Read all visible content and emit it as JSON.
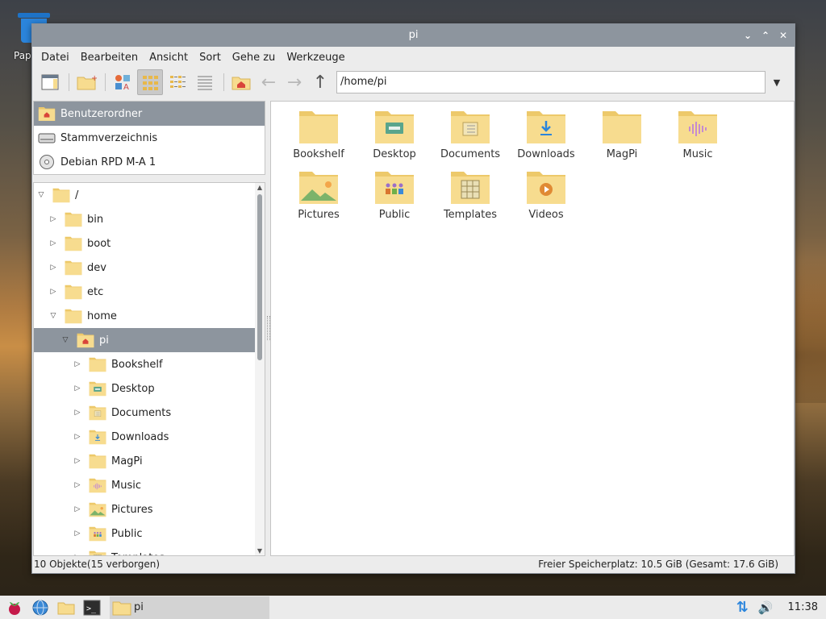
{
  "desktop": {
    "trash_label": "Papierkorb"
  },
  "window": {
    "title": "pi",
    "controls": {
      "minimize": "⌄",
      "maximize": "⌃",
      "close": "✕"
    }
  },
  "menubar": [
    "Datei",
    "Bearbeiten",
    "Ansicht",
    "Sort",
    "Gehe zu",
    "Werkzeuge"
  ],
  "toolbar": {
    "path": "/home/pi",
    "path_dropdown": "▼"
  },
  "places": [
    {
      "label": "Benutzerordner",
      "icon": "home-folder-icon",
      "selected": true
    },
    {
      "label": "Stammverzeichnis",
      "icon": "harddisk-icon",
      "selected": false
    },
    {
      "label": "Debian RPD M-A 1",
      "icon": "cdrom-icon",
      "selected": false
    }
  ],
  "tree": [
    {
      "label": "/",
      "depth": 0,
      "expander": "▽",
      "selected": false
    },
    {
      "label": "bin",
      "depth": 1,
      "expander": "▷",
      "selected": false
    },
    {
      "label": "boot",
      "depth": 1,
      "expander": "▷",
      "selected": false
    },
    {
      "label": "dev",
      "depth": 1,
      "expander": "▷",
      "selected": false
    },
    {
      "label": "etc",
      "depth": 1,
      "expander": "▷",
      "selected": false
    },
    {
      "label": "home",
      "depth": 1,
      "expander": "▽",
      "selected": false
    },
    {
      "label": "pi",
      "depth": 2,
      "expander": "▽",
      "selected": true,
      "icon": "home"
    },
    {
      "label": "Bookshelf",
      "depth": 3,
      "expander": "▷",
      "selected": false
    },
    {
      "label": "Desktop",
      "depth": 3,
      "expander": "▷",
      "selected": false,
      "icon": "desktop"
    },
    {
      "label": "Documents",
      "depth": 3,
      "expander": "▷",
      "selected": false,
      "icon": "documents"
    },
    {
      "label": "Downloads",
      "depth": 3,
      "expander": "▷",
      "selected": false,
      "icon": "downloads"
    },
    {
      "label": "MagPi",
      "depth": 3,
      "expander": "▷",
      "selected": false
    },
    {
      "label": "Music",
      "depth": 3,
      "expander": "▷",
      "selected": false,
      "icon": "music"
    },
    {
      "label": "Pictures",
      "depth": 3,
      "expander": "▷",
      "selected": false,
      "icon": "pictures"
    },
    {
      "label": "Public",
      "depth": 3,
      "expander": "▷",
      "selected": false,
      "icon": "public"
    },
    {
      "label": "Templates",
      "depth": 3,
      "expander": "▷",
      "selected": false,
      "icon": "templates"
    }
  ],
  "files": [
    {
      "name": "Bookshelf",
      "icon": "plain"
    },
    {
      "name": "Desktop",
      "icon": "desktop"
    },
    {
      "name": "Documents",
      "icon": "documents"
    },
    {
      "name": "Downloads",
      "icon": "downloads"
    },
    {
      "name": "MagPi",
      "icon": "plain"
    },
    {
      "name": "Music",
      "icon": "music"
    },
    {
      "name": "Pictures",
      "icon": "pictures"
    },
    {
      "name": "Public",
      "icon": "public"
    },
    {
      "name": "Templates",
      "icon": "templates"
    },
    {
      "name": "Videos",
      "icon": "videos"
    }
  ],
  "status": {
    "left": "10 Objekte(15 verborgen)",
    "right": "Freier Speicherplatz: 10.5 GiB (Gesamt: 17.6 GiB)"
  },
  "taskbar": {
    "task_label": "pi",
    "clock": "11:38"
  },
  "colors": {
    "folder": "#f7dc8f",
    "folder_tab": "#edc96a",
    "selection": "#8d959e",
    "accent_blue": "#2b85dc"
  }
}
